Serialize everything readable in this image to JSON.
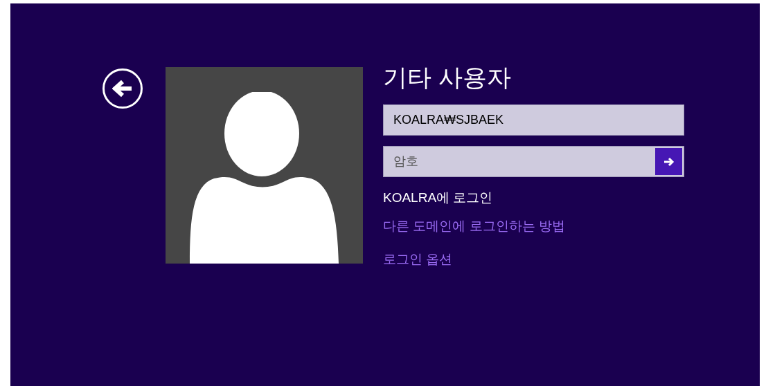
{
  "title": "기타 사용자",
  "username": {
    "value": "KOALRA₩SJBAEK"
  },
  "password": {
    "placeholder": "암호"
  },
  "sign_in_to": "KOALRA에 로그인",
  "links": [
    "다른 도메인에 로그인하는 방법",
    "로그인 옵션"
  ]
}
